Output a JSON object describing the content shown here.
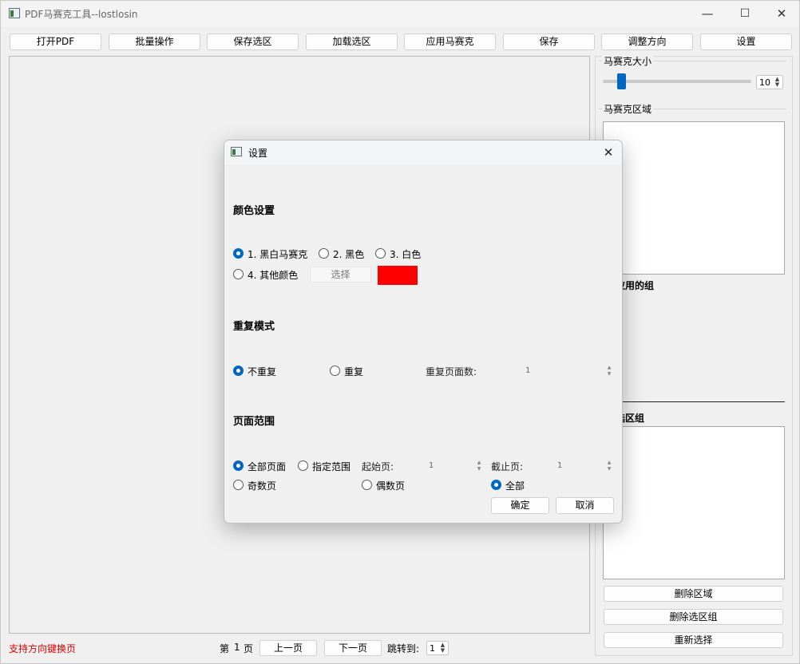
{
  "window": {
    "title": "PDF马赛克工具--lostlosin",
    "minimize": "—",
    "maximize": "☐",
    "close": "✕"
  },
  "toolbar": {
    "open_pdf": "打开PDF",
    "batch": "批量操作",
    "save_selection": "保存选区",
    "load_selection": "加载选区",
    "apply_mosaic": "应用马赛克",
    "save": "保存",
    "adjust_direction": "调整方向",
    "settings": "设置"
  },
  "right_panel": {
    "mosaic_size_title": "马赛克大小",
    "mosaic_size_value": "10",
    "mosaic_size_slider_fraction": 0.1,
    "mosaic_region_title": "马赛克区域",
    "applied_groups_label": "应用的组",
    "selection_groups_label": "选区组",
    "delete_region": "删除区域",
    "delete_selection_group": "删除选区组",
    "reselect": "重新选择"
  },
  "statusbar": {
    "hint": "支持方向键换页",
    "page_prefix": "第",
    "page_number": "1",
    "page_suffix": "页",
    "prev_page": "上一页",
    "next_page": "下一页",
    "jump_to": "跳转到:",
    "jump_value": "1"
  },
  "dialog": {
    "title": "设置",
    "close": "✕",
    "color_section": "颜色设置",
    "color_options": [
      "1. 黑白马赛克",
      "2. 黑色",
      "3. 白色",
      "4. 其他颜色"
    ],
    "color_selected_index": 0,
    "choose_button": "选择",
    "custom_color": "#ff0000",
    "repeat_section": "重复模式",
    "no_repeat": "不重复",
    "repeat": "重复",
    "repeat_pages_label": "重复页面数:",
    "repeat_pages_value": "1",
    "range_section": "页面范围",
    "all_pages": "全部页面",
    "specified_range": "指定范围",
    "start_page_label": "起始页:",
    "start_page_value": "1",
    "end_page_label": "截止页:",
    "end_page_value": "1",
    "odd_pages": "奇数页",
    "even_pages": "偶数页",
    "all": "全部",
    "ok": "确定",
    "cancel": "取消"
  },
  "colors": {
    "accent": "#0067c0",
    "hint_red": "#e00000"
  }
}
